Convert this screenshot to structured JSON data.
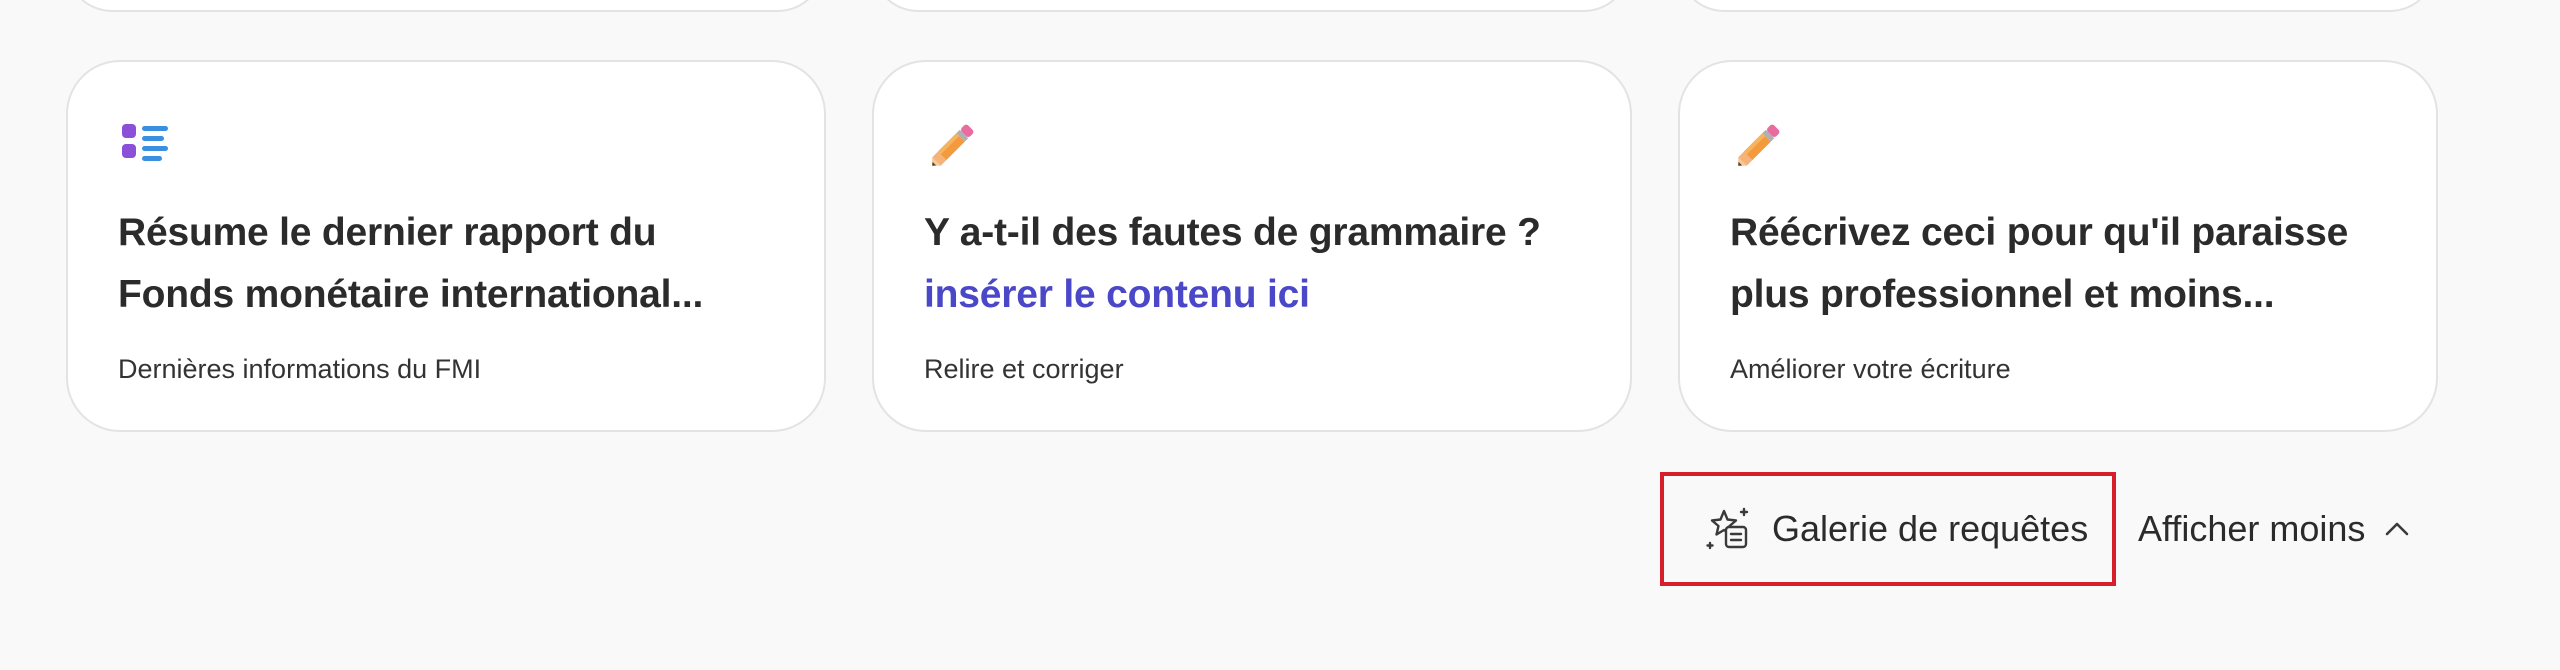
{
  "cards": [
    {
      "icon": "list-icon",
      "title_line1": "Résume le dernier rapport du",
      "title_line2": "Fonds monétaire international...",
      "subtitle": "Dernières informations du FMI"
    },
    {
      "icon": "pencil-icon",
      "title_line1": "Y a-t-il des fautes de grammaire ?",
      "title_line2": "insérer le contenu ici",
      "subtitle": "Relire et corriger"
    },
    {
      "icon": "pencil-icon",
      "title_line1": "Réécrivez ceci pour qu'il paraisse",
      "title_line2": "plus professionnel et moins...",
      "subtitle": "Améliorer votre écriture"
    }
  ],
  "footer": {
    "gallery_label": "Galerie de requêtes",
    "gallery_icon": "prompt-gallery-icon",
    "show_less_label": "Afficher moins",
    "show_less_icon": "chevron-up-icon"
  },
  "colors": {
    "accent": "#4a47c9",
    "highlight_border": "#d61f2a",
    "card_border": "#e3e3e3",
    "background": "#f9f9f9"
  }
}
